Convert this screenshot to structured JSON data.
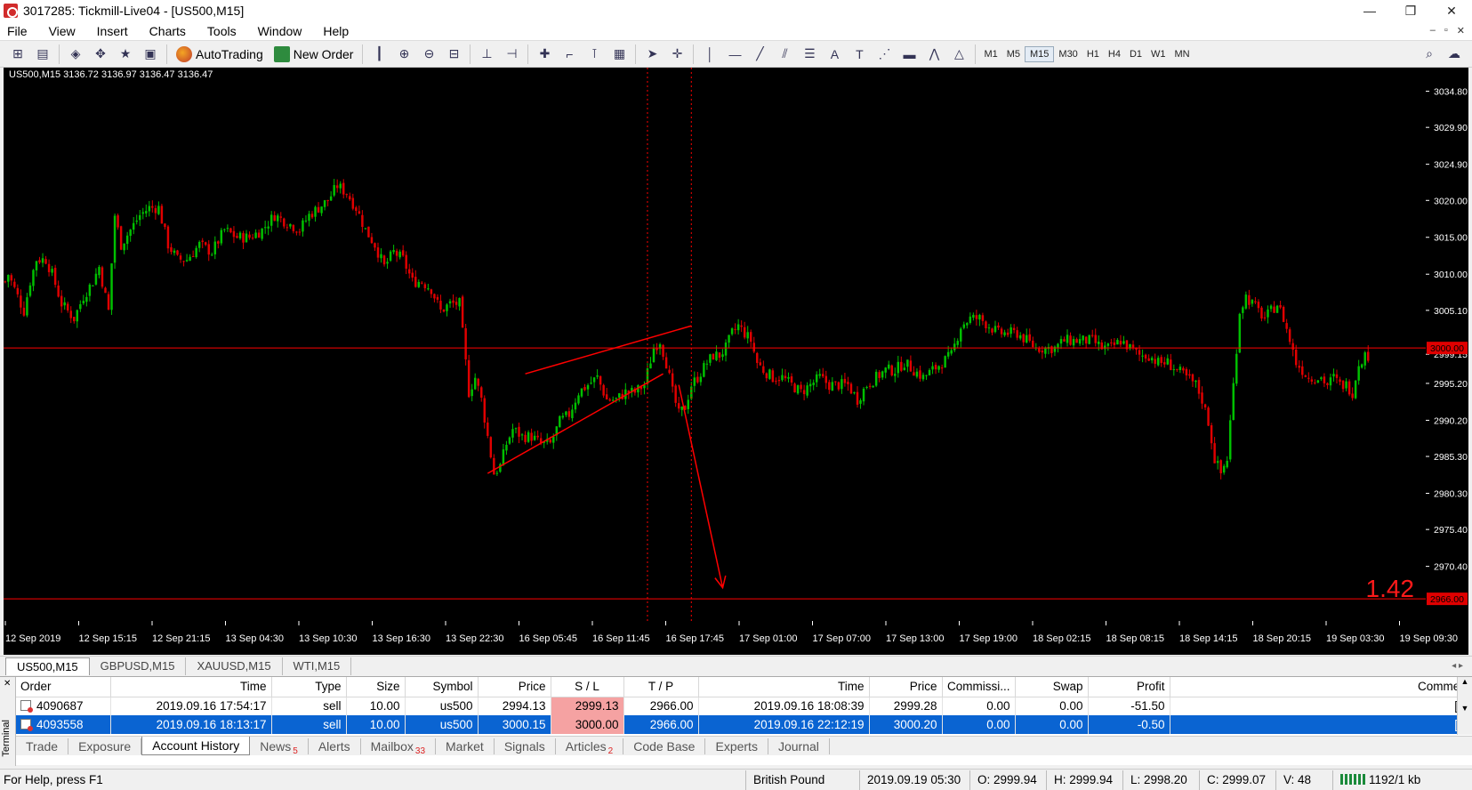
{
  "window": {
    "title": "3017285: Tickmill-Live04 - [US500,M15]",
    "minimize": "—",
    "restore": "❐",
    "close": "✕"
  },
  "menu": {
    "items": [
      "File",
      "View",
      "Insert",
      "Charts",
      "Tools",
      "Window",
      "Help"
    ],
    "mdi": [
      "–",
      "▫",
      "✕"
    ]
  },
  "toolbar": {
    "autotrading_label": "AutoTrading",
    "new_order_label": "New Order",
    "timeframes": [
      "M1",
      "M5",
      "M15",
      "M30",
      "H1",
      "H4",
      "D1",
      "W1",
      "MN"
    ],
    "active_timeframe": "M15"
  },
  "chart": {
    "header": "US500,M15  3136.72 3136.97 3136.47 3136.47",
    "price_labels": [
      "3034.80",
      "3029.90",
      "3024.90",
      "3020.00",
      "3015.00",
      "3010.00",
      "3005.10",
      "2999.15",
      "2995.20",
      "2990.20",
      "2985.30",
      "2980.30",
      "2975.40",
      "2970.40",
      "2966.00"
    ],
    "price_values": [
      3034.8,
      3029.9,
      3024.9,
      3020.0,
      3015.0,
      3010.0,
      3005.1,
      2999.15,
      2995.2,
      2990.2,
      2985.3,
      2980.3,
      2975.4,
      2970.4,
      2966.0
    ],
    "stop_line_label": "3000.00",
    "stop_line_value": 3000.0,
    "tp_line_label": "2966.00",
    "tp_line_value": 2966.0,
    "time_labels": [
      "12 Sep 2019",
      "12 Sep 15:15",
      "12 Sep 21:15",
      "13 Sep 04:30",
      "13 Sep 10:30",
      "13 Sep 16:30",
      "13 Sep 22:30",
      "16 Sep 05:45",
      "16 Sep 11:45",
      "16 Sep 17:45",
      "17 Sep 01:00",
      "17 Sep 07:00",
      "17 Sep 13:00",
      "17 Sep 19:00",
      "18 Sep 02:15",
      "18 Sep 08:15",
      "18 Sep 14:15",
      "18 Sep 20:15",
      "19 Sep 03:30",
      "19 Sep 09:30"
    ],
    "ratio_text": "1.42",
    "colors": {
      "bg": "#000000",
      "bull": "#00c000",
      "bear": "#e00000",
      "line": "#ff0000",
      "grid_text": "#ffffff"
    }
  },
  "chart_data": {
    "type": "candlestick",
    "title": "US500,M15",
    "ylim": [
      2963.0,
      3038.0
    ],
    "path": [
      [
        0,
        3009
      ],
      [
        1,
        3010
      ],
      [
        3,
        3008
      ],
      [
        6,
        3005
      ],
      [
        8,
        3009
      ],
      [
        10,
        3012
      ],
      [
        13,
        3012
      ],
      [
        15,
        3010
      ],
      [
        18,
        3006
      ],
      [
        22,
        3004
      ],
      [
        25,
        3007
      ],
      [
        28,
        3009
      ],
      [
        30,
        3011
      ],
      [
        33,
        3005
      ],
      [
        35,
        3018
      ],
      [
        37,
        3014
      ],
      [
        40,
        3016
      ],
      [
        43,
        3018
      ],
      [
        46,
        3019
      ],
      [
        49,
        3019
      ],
      [
        52,
        3014
      ],
      [
        55,
        3012
      ],
      [
        58,
        3012
      ],
      [
        62,
        3014
      ],
      [
        66,
        3013
      ],
      [
        70,
        3016
      ],
      [
        74,
        3015
      ],
      [
        78,
        3015
      ],
      [
        82,
        3016
      ],
      [
        86,
        3018
      ],
      [
        90,
        3017
      ],
      [
        94,
        3016
      ],
      [
        97,
        3018
      ],
      [
        100,
        3019
      ],
      [
        103,
        3020
      ],
      [
        106,
        3022
      ],
      [
        109,
        3021
      ],
      [
        112,
        3019
      ],
      [
        115,
        3016
      ],
      [
        118,
        3014
      ],
      [
        121,
        3011
      ],
      [
        124,
        3013
      ],
      [
        127,
        3012
      ],
      [
        130,
        3009
      ],
      [
        133,
        3009
      ],
      [
        136,
        3008
      ],
      [
        139,
        3005
      ],
      [
        142,
        3006
      ],
      [
        145,
        3006
      ],
      [
        148,
        2994
      ],
      [
        150,
        2996
      ],
      [
        152,
        2993
      ],
      [
        154,
        2988
      ],
      [
        156,
        2983
      ],
      [
        158,
        2984
      ],
      [
        160,
        2987
      ],
      [
        162,
        2989
      ],
      [
        165,
        2988
      ],
      [
        168,
        2988
      ],
      [
        171,
        2987
      ],
      [
        174,
        2987
      ],
      [
        177,
        2990
      ],
      [
        180,
        2991
      ],
      [
        183,
        2994
      ],
      [
        186,
        2995
      ],
      [
        189,
        2996
      ],
      [
        192,
        2993
      ],
      [
        195,
        2993
      ],
      [
        198,
        2994
      ],
      [
        201,
        2994
      ],
      [
        204,
        2995
      ],
      [
        207,
        3000
      ],
      [
        209,
        3001
      ],
      [
        211,
        2998
      ],
      [
        213,
        2994
      ],
      [
        215,
        2991
      ],
      [
        217,
        2992
      ],
      [
        219,
        2995
      ],
      [
        221,
        2996
      ],
      [
        224,
        2998
      ],
      [
        226,
        2999
      ],
      [
        228,
        2999
      ],
      [
        230,
        3000
      ],
      [
        232,
        3002
      ],
      [
        234,
        3003
      ],
      [
        236,
        3002
      ],
      [
        238,
        3001
      ],
      [
        240,
        2998
      ],
      [
        242,
        2997
      ],
      [
        245,
        2996
      ],
      [
        248,
        2996
      ],
      [
        251,
        2995
      ],
      [
        254,
        2994
      ],
      [
        257,
        2995
      ],
      [
        260,
        2996
      ],
      [
        263,
        2995
      ],
      [
        266,
        2995
      ],
      [
        269,
        2995
      ],
      [
        272,
        2993
      ],
      [
        275,
        2995
      ],
      [
        278,
        2996
      ],
      [
        281,
        2997
      ],
      [
        284,
        2997
      ],
      [
        287,
        2998
      ],
      [
        290,
        2997
      ],
      [
        293,
        2996
      ],
      [
        296,
        2997
      ],
      [
        299,
        2998
      ],
      [
        302,
        2999
      ],
      [
        305,
        3003
      ],
      [
        308,
        3004
      ],
      [
        311,
        3004
      ],
      [
        314,
        3003
      ],
      [
        317,
        3002
      ],
      [
        320,
        3002
      ],
      [
        323,
        3002
      ],
      [
        326,
        3001
      ],
      [
        329,
        3000
      ],
      [
        332,
        3000
      ],
      [
        335,
        3000
      ],
      [
        338,
        3001
      ],
      [
        341,
        3001
      ],
      [
        344,
        3001
      ],
      [
        347,
        3001
      ],
      [
        350,
        3000
      ],
      [
        353,
        3000
      ],
      [
        356,
        3001
      ],
      [
        359,
        3000
      ],
      [
        362,
        2999
      ],
      [
        365,
        2999
      ],
      [
        368,
        2998
      ],
      [
        371,
        2998
      ],
      [
        374,
        2997
      ],
      [
        377,
        2996
      ],
      [
        380,
        2995
      ],
      [
        382,
        2993
      ],
      [
        384,
        2990
      ],
      [
        386,
        2985
      ],
      [
        388,
        2983
      ],
      [
        390,
        2985
      ],
      [
        392,
        2995
      ],
      [
        394,
        3005
      ],
      [
        396,
        3007
      ],
      [
        398,
        3006
      ],
      [
        400,
        3005
      ],
      [
        402,
        3004
      ],
      [
        404,
        3005
      ],
      [
        406,
        3006
      ],
      [
        408,
        3004
      ],
      [
        410,
        3001
      ],
      [
        412,
        2998
      ],
      [
        414,
        2997
      ],
      [
        416,
        2996
      ],
      [
        418,
        2996
      ],
      [
        420,
        2996
      ],
      [
        422,
        2995
      ],
      [
        424,
        2996
      ],
      [
        426,
        2995
      ],
      [
        428,
        2995
      ],
      [
        430,
        2994
      ],
      [
        432,
        2998
      ],
      [
        434,
        2999
      ]
    ],
    "annotations": [
      {
        "type": "trendline",
        "from": [
          154,
          2983
        ],
        "to": [
          210,
          2996.5
        ]
      },
      {
        "type": "trendline",
        "from": [
          166,
          2996.5
        ],
        "to": [
          219,
          3003
        ]
      },
      {
        "type": "vline",
        "x": 205
      },
      {
        "type": "vline",
        "x": 219
      },
      {
        "type": "hline",
        "y": 3000.0
      },
      {
        "type": "hline",
        "y": 2966.0
      },
      {
        "type": "arrow",
        "from": [
          215,
          2995
        ],
        "to": [
          229,
          2967.5
        ]
      }
    ]
  },
  "symbol_tabs": {
    "items": [
      "US500,M15",
      "GBPUSD,M15",
      "XAUUSD,M15",
      "WTI,M15"
    ],
    "active": 0,
    "arrows": "◂ ▸"
  },
  "terminal": {
    "side_label": "Terminal",
    "close": "✕",
    "columns": [
      "Order",
      "Time",
      "Type",
      "Size",
      "Symbol",
      "Price",
      "S / L",
      "T / P",
      "Time",
      "Price",
      "Commissi...",
      "Swap",
      "Profit",
      "Comment"
    ],
    "rows": [
      [
        "4090687",
        "2019.09.16 17:54:17",
        "sell",
        "10.00",
        "us500",
        "2994.13",
        "2999.13",
        "2966.00",
        "2019.09.16 18:08:39",
        "2999.28",
        "0.00",
        "0.00",
        "-51.50",
        "[sl]"
      ],
      [
        "4093558",
        "2019.09.16 18:13:17",
        "sell",
        "10.00",
        "us500",
        "3000.15",
        "3000.00",
        "2966.00",
        "2019.09.16 22:12:19",
        "3000.20",
        "0.00",
        "0.00",
        "-0.50",
        "[sl]"
      ]
    ],
    "selected_row": 1,
    "tabs": [
      {
        "label": "Trade",
        "badge": ""
      },
      {
        "label": "Exposure",
        "badge": ""
      },
      {
        "label": "Account History",
        "badge": ""
      },
      {
        "label": "News",
        "badge": "5"
      },
      {
        "label": "Alerts",
        "badge": ""
      },
      {
        "label": "Mailbox",
        "badge": "33"
      },
      {
        "label": "Market",
        "badge": ""
      },
      {
        "label": "Signals",
        "badge": ""
      },
      {
        "label": "Articles",
        "badge": "2"
      },
      {
        "label": "Code Base",
        "badge": ""
      },
      {
        "label": "Experts",
        "badge": ""
      },
      {
        "label": "Journal",
        "badge": ""
      }
    ],
    "active_tab": 2
  },
  "status": {
    "help": "For Help, press F1",
    "profile": "British Pound",
    "datetime": "2019.09.19 05:30",
    "open": "O: 2999.94",
    "high": "H: 2999.94",
    "low": "L: 2998.20",
    "close": "C: 2999.07",
    "volume": "V: 48",
    "traffic": "1192/1 kb"
  }
}
